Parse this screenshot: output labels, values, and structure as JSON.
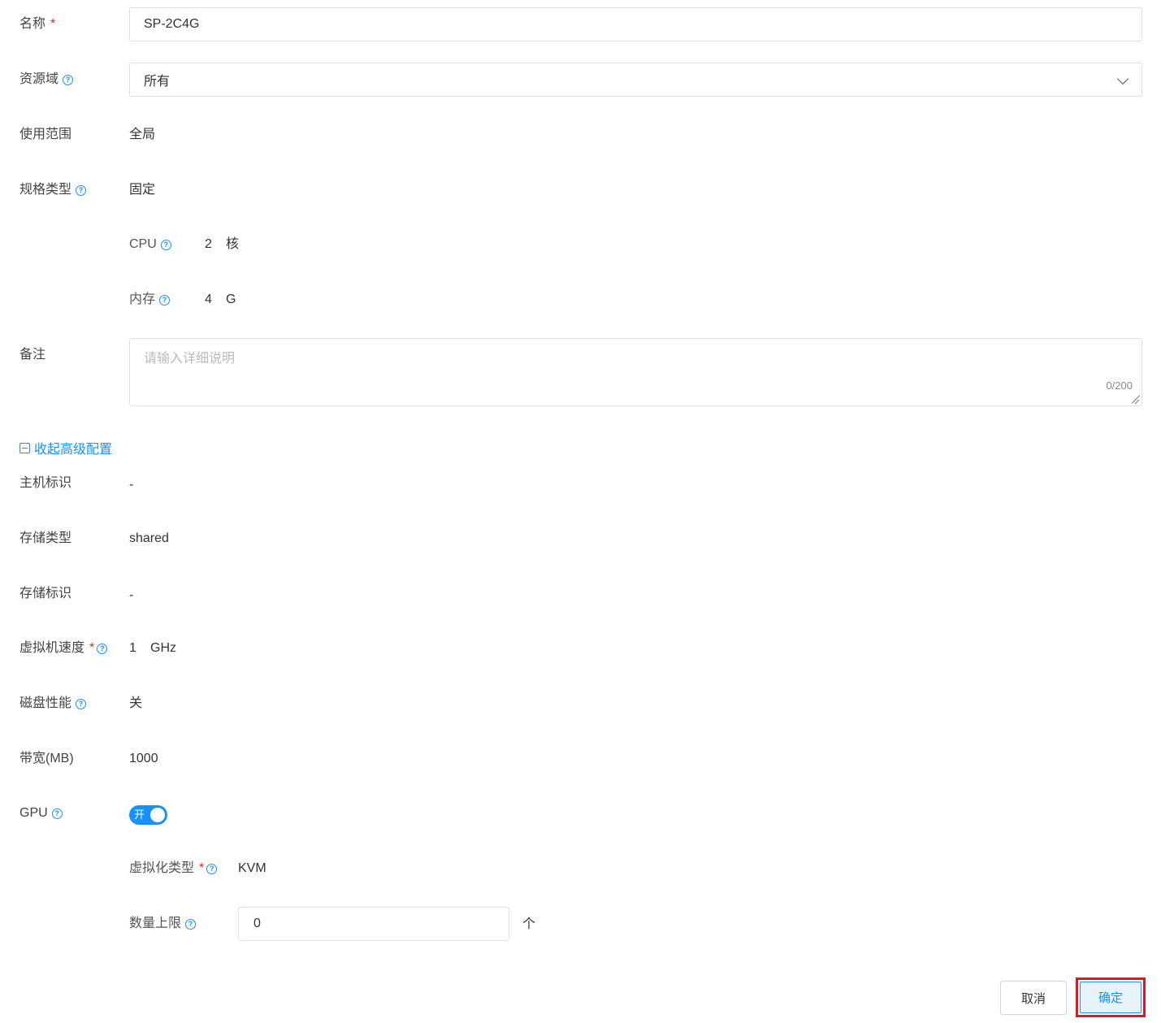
{
  "form": {
    "name": {
      "label": "名称",
      "required": "*",
      "value": "SP-2C4G"
    },
    "resource_domain": {
      "label": "资源域",
      "help": "?",
      "value": "所有"
    },
    "scope": {
      "label": "使用范围",
      "value": "全局"
    },
    "spec_type": {
      "label": "规格类型",
      "help": "?",
      "value": "固定"
    },
    "cpu": {
      "label": "CPU",
      "help": "?",
      "value": "2",
      "unit": "核"
    },
    "memory": {
      "label": "内存",
      "help": "?",
      "value": "4",
      "unit": "G"
    },
    "remark": {
      "label": "备注",
      "placeholder": "请输入详细说明",
      "count": "0/200"
    }
  },
  "advanced": {
    "toggle_label": "收起高级配置",
    "host_tag": {
      "label": "主机标识",
      "value": "-"
    },
    "storage_type": {
      "label": "存储类型",
      "value": "shared"
    },
    "storage_tag": {
      "label": "存储标识",
      "value": "-"
    },
    "vm_speed": {
      "label": "虚拟机速度",
      "required": "*",
      "help": "?",
      "value": "1",
      "unit": "GHz"
    },
    "disk_perf": {
      "label": "磁盘性能",
      "help": "?",
      "value": "关"
    },
    "bandwidth": {
      "label": "带宽(MB)",
      "value": "1000"
    },
    "gpu": {
      "label": "GPU",
      "help": "?",
      "switch_text": "开",
      "enabled": true
    },
    "virt_type": {
      "label": "虚拟化类型",
      "required": "*",
      "help": "?",
      "value": "KVM"
    },
    "count_limit": {
      "label": "数量上限",
      "help": "?",
      "value": "0",
      "unit": "个"
    }
  },
  "footer": {
    "cancel": "取消",
    "confirm": "确定"
  },
  "colors": {
    "accent": "#1890ff",
    "required": "#f5222d",
    "highlight_border": "#e5141e"
  }
}
